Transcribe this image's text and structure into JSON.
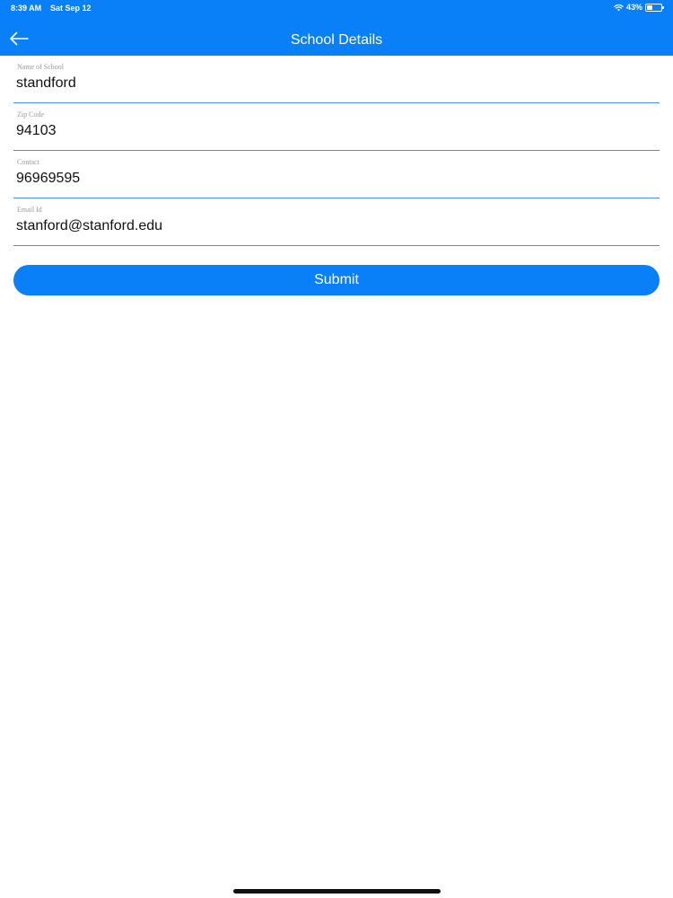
{
  "status_bar": {
    "time": "8:39 AM",
    "date": "Sat Sep 12",
    "battery_text": "43%",
    "battery_level": 0.43,
    "icons": [
      "wifi-icon",
      "battery-icon"
    ]
  },
  "header": {
    "title": "School Details",
    "back_icon": "arrow-left-icon"
  },
  "form": {
    "school_name": {
      "label": "Name of School",
      "value": "standford"
    },
    "zip_code": {
      "label": "Zip Code",
      "value": "94103"
    },
    "contact": {
      "label": "Contact",
      "value": "96969595"
    },
    "email": {
      "label": "Email Id",
      "value": "stanford@stanford.edu"
    }
  },
  "submit": {
    "label": "Submit"
  },
  "colors": {
    "accent": "#0a80f8",
    "divider": "#4d8ee8",
    "label": "#9a9a9a",
    "text": "#111111"
  }
}
